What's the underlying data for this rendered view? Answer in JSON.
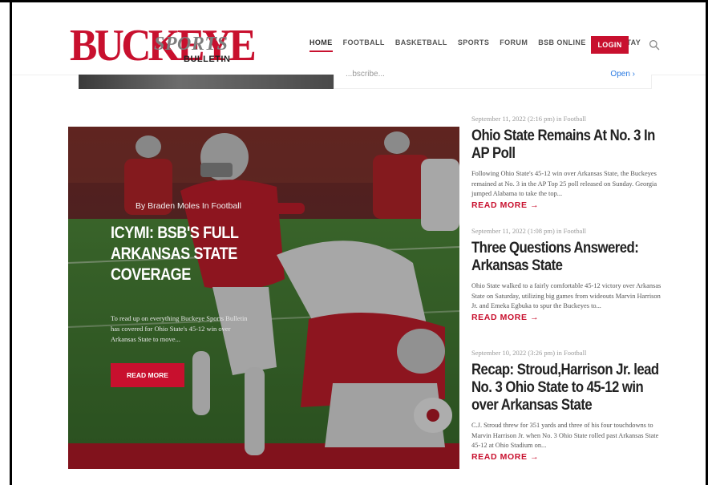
{
  "header": {
    "logo": {
      "big": "BUCKEYE",
      "script": "SPORTS",
      "small": "BULLETIN"
    },
    "nav": [
      "HOME",
      "FOOTBALL",
      "BASKETBALL",
      "SPORTS",
      "FORUM",
      "BSB ONLINE",
      "EAT & STAY"
    ],
    "login_label": "LOGIN"
  },
  "strip": {
    "cut_text": "...bscribe...",
    "open_label": "Open ›"
  },
  "hero": {
    "byline": "By Braden Moles In Football",
    "title": "ICYMI: BSB'S FULL ARKANSAS STATE COVERAGE",
    "excerpt": "To read up on everything Buckeye Sports Bulletin has covered for Ohio State's 45-12 win over Arkansas State to move...",
    "read_more": "READ MORE"
  },
  "articles": [
    {
      "meta": "September 11, 2022 (2:16 pm) in Football",
      "headline": "Ohio State Remains At No. 3 In AP Poll",
      "excerpt": "Following Ohio State's 45-12 win over Arkansas State, the Buckeyes remained at No. 3 in the AP Top 25 poll released on Sunday. Georgia jumped Alabama to take the top...",
      "read_more": "READ MORE →"
    },
    {
      "meta": "September 11, 2022 (1:08 pm) in Football",
      "headline": "Three Questions Answered: Arkansas State",
      "excerpt": "Ohio State walked to a fairly comfortable 45-12 victory over Arkansas State on Saturday, utilizing big games from wideouts Marvin Harrison Jr. and Emeka Egbuka to spur the Buckeyes to...",
      "read_more": "READ MORE →"
    },
    {
      "meta": "September 10, 2022 (3:26 pm) in Football",
      "headline": "Recap: Stroud,Harrison Jr. lead No. 3 Ohio State to 45-12 win over Arkansas State",
      "excerpt": "C.J. Stroud threw for 351 yards and three of his four touchdowns to Marvin Harrison Jr. when No. 3 Ohio State rolled past Arkansas State 45-12 at Ohio Stadium on...",
      "read_more": "READ MORE →"
    }
  ],
  "colors": {
    "accent": "#c8102e",
    "text": "#222222",
    "meta": "#999999"
  }
}
